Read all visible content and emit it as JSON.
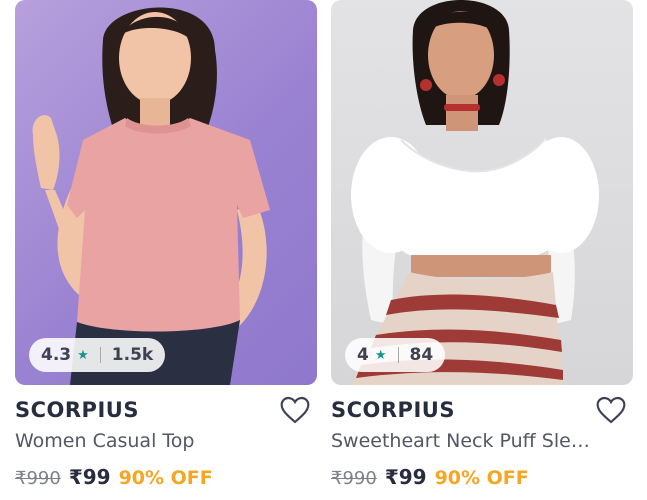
{
  "products": [
    {
      "brand": "SCORPIUS",
      "title": "Women Casual Top",
      "rating": "4.3",
      "rating_count": "1.5k",
      "mrp": "₹990",
      "price": "₹99",
      "discount": "90% OFF",
      "image_bg": "#9a82d2",
      "shirt_color": "#e9a3a3"
    },
    {
      "brand": "SCORPIUS",
      "title": "Sweetheart Neck Puff Sle…",
      "rating": "4",
      "rating_count": "84",
      "mrp": "₹990",
      "price": "₹99",
      "discount": "90% OFF",
      "image_bg": "#dcdcde",
      "shirt_color": "#ffffff"
    }
  ],
  "icons": {
    "star": "star-icon",
    "wishlist": "heart-icon"
  },
  "colors": {
    "discount": "#f5a623",
    "rating_star": "#14958f"
  }
}
